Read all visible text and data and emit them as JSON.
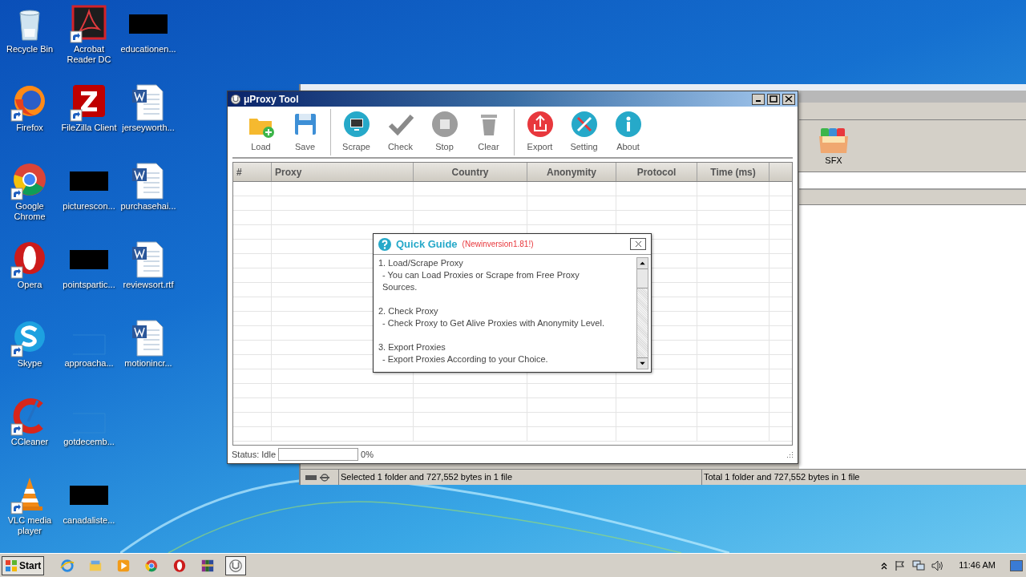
{
  "desktop": {
    "icons": [
      {
        "label": "Recycle Bin",
        "kind": "recycle",
        "shortcut": false
      },
      {
        "label": "Firefox",
        "kind": "firefox",
        "shortcut": true
      },
      {
        "label": "Google Chrome",
        "kind": "chrome",
        "shortcut": true
      },
      {
        "label": "Opera",
        "kind": "opera",
        "shortcut": true
      },
      {
        "label": "Skype",
        "kind": "skype",
        "shortcut": true
      },
      {
        "label": "CCleaner",
        "kind": "ccleaner",
        "shortcut": true
      },
      {
        "label": "VLC media player",
        "kind": "vlc",
        "shortcut": true
      },
      {
        "label": "Acrobat Reader DC",
        "kind": "acrobat",
        "shortcut": true
      },
      {
        "label": "FileZilla Client",
        "kind": "filezilla",
        "shortcut": true
      },
      {
        "label": "picturescon...",
        "kind": "redacted",
        "shortcut": false
      },
      {
        "label": "pointspartic...",
        "kind": "redacted",
        "shortcut": false
      },
      {
        "label": "approacha...",
        "kind": "blank",
        "shortcut": false
      },
      {
        "label": "gotdecemb...",
        "kind": "blank",
        "shortcut": false
      },
      {
        "label": "canadaliste...",
        "kind": "redacted",
        "shortcut": false
      },
      {
        "label": "educationen...",
        "kind": "redacted",
        "shortcut": false
      },
      {
        "label": "jerseyworth...",
        "kind": "word",
        "shortcut": false
      },
      {
        "label": "purchasehai...",
        "kind": "word",
        "shortcut": false
      },
      {
        "label": "reviewsort.rtf",
        "kind": "word",
        "shortcut": false
      },
      {
        "label": "motionincr...",
        "kind": "word",
        "shortcut": false
      }
    ]
  },
  "background_window": {
    "toolbar_items": [
      {
        "label": "SFX",
        "kind": "sfx"
      }
    ],
    "status_bar": [
      "Selected 1 folder and 727,552 bytes in 1 file",
      "Total 1 folder and 727,552 bytes in 1 file"
    ]
  },
  "app_window": {
    "title": "μProxy Tool",
    "toolbar": [
      [
        {
          "label": "Load",
          "kind": "load"
        },
        {
          "label": "Save",
          "kind": "save"
        }
      ],
      [
        {
          "label": "Scrape",
          "kind": "scrape"
        },
        {
          "label": "Check",
          "kind": "check"
        },
        {
          "label": "Stop",
          "kind": "stop"
        },
        {
          "label": "Clear",
          "kind": "clear"
        }
      ],
      [
        {
          "label": "Export",
          "kind": "export"
        },
        {
          "label": "Setting",
          "kind": "setting"
        },
        {
          "label": "About",
          "kind": "about"
        }
      ]
    ],
    "table": {
      "columns": [
        "#",
        "Proxy",
        "Country",
        "Anonymity",
        "Protocol",
        "Time (ms)"
      ]
    },
    "status": {
      "label": "Status: Idle",
      "level": 0,
      "percent": "0%"
    }
  },
  "quick_guide": {
    "title": "Quick Guide",
    "note": "(Newinversion1.81!)",
    "sections": [
      {
        "heading": "1. Load/Scrape Proxy",
        "detail": "- You can Load Proxies or Scrape from Free Proxy Sources."
      },
      {
        "heading": "2. Check Proxy",
        "detail": "- Check Proxy to Get Alive Proxies with Anonymity Level."
      },
      {
        "heading": "3. Export Proxies",
        "detail": "- Export Proxies According to your Choice."
      }
    ]
  },
  "taskbar": {
    "start": "Start",
    "apps": [
      {
        "kind": "ie",
        "selected": false
      },
      {
        "kind": "explorer",
        "selected": false
      },
      {
        "kind": "media",
        "selected": false
      },
      {
        "kind": "chrome",
        "selected": false
      },
      {
        "kind": "opera",
        "selected": false
      },
      {
        "kind": "winrar",
        "selected": false
      },
      {
        "kind": "uproxy",
        "selected": true
      }
    ],
    "clock": "11:46 AM"
  }
}
